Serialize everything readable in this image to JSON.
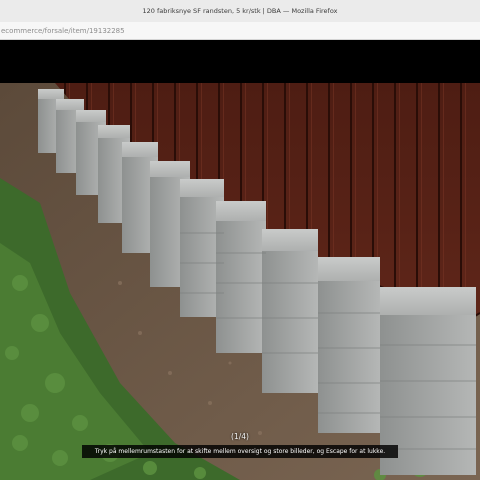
{
  "window": {
    "title": "120 fabriksnye SF randsten, 5 kr/stk | DBA — Mozilla Firefox"
  },
  "address_bar": {
    "url_visible": "ecommerce/forsale/item/19132285"
  },
  "viewer": {
    "counter": "(1/4)",
    "hint": "Tryk på mellemrumstasten for at skifte mellem oversigt og store billeder, og Escape for at lukke."
  },
  "colors": {
    "fence": "#5e2418",
    "pavers": "#a8aaa9",
    "grass": "#3f6b2a",
    "soil": "#6e5a46"
  }
}
